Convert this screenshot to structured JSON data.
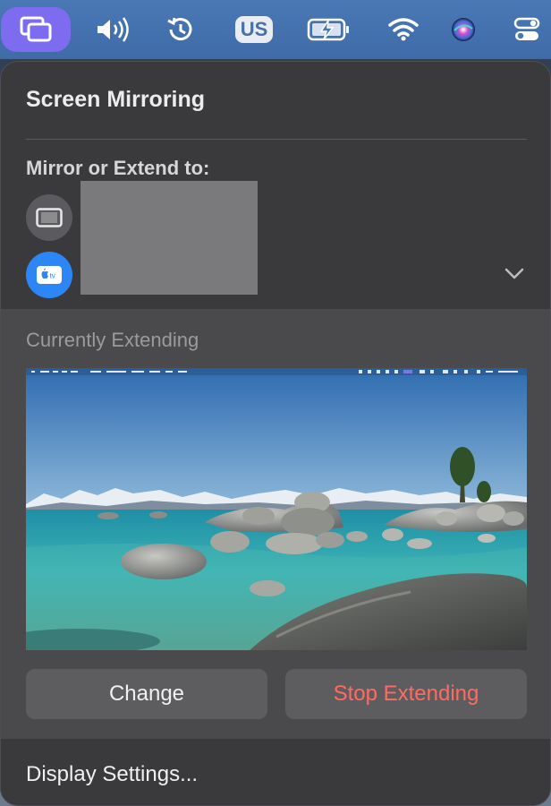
{
  "menubar": {
    "items": [
      {
        "icon": "screen-mirroring-icon"
      },
      {
        "icon": "volume-icon"
      },
      {
        "icon": "time-machine-icon"
      },
      {
        "icon": "input-source-icon",
        "label": "US"
      },
      {
        "icon": "battery-charging-icon"
      },
      {
        "icon": "wifi-icon"
      },
      {
        "icon": "siri-icon"
      },
      {
        "icon": "control-center-icon"
      }
    ],
    "active_color": "#7d6bf0"
  },
  "panel": {
    "title": "Screen Mirroring",
    "mirror_label": "Mirror or Extend to:",
    "devices": [
      {
        "icon": "ipad-icon"
      },
      {
        "icon": "apple-tv-icon",
        "badge": "tv"
      }
    ],
    "currently_label": "Currently Extending",
    "change_label": "Change",
    "stop_label": "Stop Extending",
    "footer_label": "Display Settings...",
    "accent": "#2d86f5",
    "stop_color": "#ff6b63"
  }
}
